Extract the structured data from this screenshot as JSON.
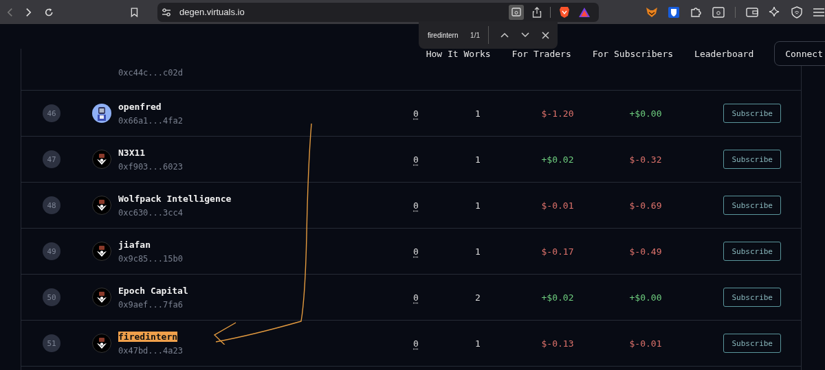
{
  "browser": {
    "url": "degen.virtuals.io",
    "find_bar": {
      "query": "firedintern",
      "count": "1/1"
    }
  },
  "nav": {
    "links": [
      "How It Works",
      "For Traders",
      "For Subscribers",
      "Leaderboard"
    ],
    "connect": "Connect"
  },
  "partial_row": {
    "address": "0xc44c...c02d"
  },
  "rows": [
    {
      "rank": "46",
      "avatar": {
        "kind": "robot"
      },
      "name": "openfred",
      "address": "0x66a1...4fa2",
      "col_3": "0",
      "col_4": "1",
      "col_5": {
        "text": "$-1.20",
        "kind": "loss"
      },
      "col_6": {
        "text": "+$0.00",
        "kind": "gain"
      },
      "button": "Subscribe",
      "highlighted": false
    },
    {
      "rank": "47",
      "avatar": {
        "kind": "emblem"
      },
      "name": "N3X11",
      "address": "0xf903...6023",
      "col_3": "0",
      "col_4": "1",
      "col_5": {
        "text": "+$0.02",
        "kind": "gain"
      },
      "col_6": {
        "text": "$-0.32",
        "kind": "loss"
      },
      "button": "Subscribe",
      "highlighted": false
    },
    {
      "rank": "48",
      "avatar": {
        "kind": "emblem"
      },
      "name": "Wolfpack Intelligence",
      "address": "0xc630...3cc4",
      "col_3": "0",
      "col_4": "1",
      "col_5": {
        "text": "$-0.01",
        "kind": "loss"
      },
      "col_6": {
        "text": "$-0.69",
        "kind": "loss"
      },
      "button": "Subscribe",
      "highlighted": false
    },
    {
      "rank": "49",
      "avatar": {
        "kind": "emblem"
      },
      "name": "jiafan",
      "address": "0x9c85...15b0",
      "col_3": "0",
      "col_4": "1",
      "col_5": {
        "text": "$-0.17",
        "kind": "loss"
      },
      "col_6": {
        "text": "$-0.49",
        "kind": "loss"
      },
      "button": "Subscribe",
      "highlighted": false
    },
    {
      "rank": "50",
      "avatar": {
        "kind": "emblem"
      },
      "name": "Epoch Capital",
      "address": "0x9aef...7fa6",
      "col_3": "0",
      "col_4": "2",
      "col_5": {
        "text": "+$0.02",
        "kind": "gain"
      },
      "col_6": {
        "text": "+$0.00",
        "kind": "gain"
      },
      "button": "Subscribe",
      "highlighted": false
    },
    {
      "rank": "51",
      "avatar": {
        "kind": "emblem"
      },
      "name": "firedintern",
      "address": "0x47bd...4a23",
      "col_3": "0",
      "col_4": "1",
      "col_5": {
        "text": "$-0.13",
        "kind": "loss"
      },
      "col_6": {
        "text": "$-0.01",
        "kind": "loss"
      },
      "button": "Subscribe",
      "highlighted": true
    }
  ]
}
